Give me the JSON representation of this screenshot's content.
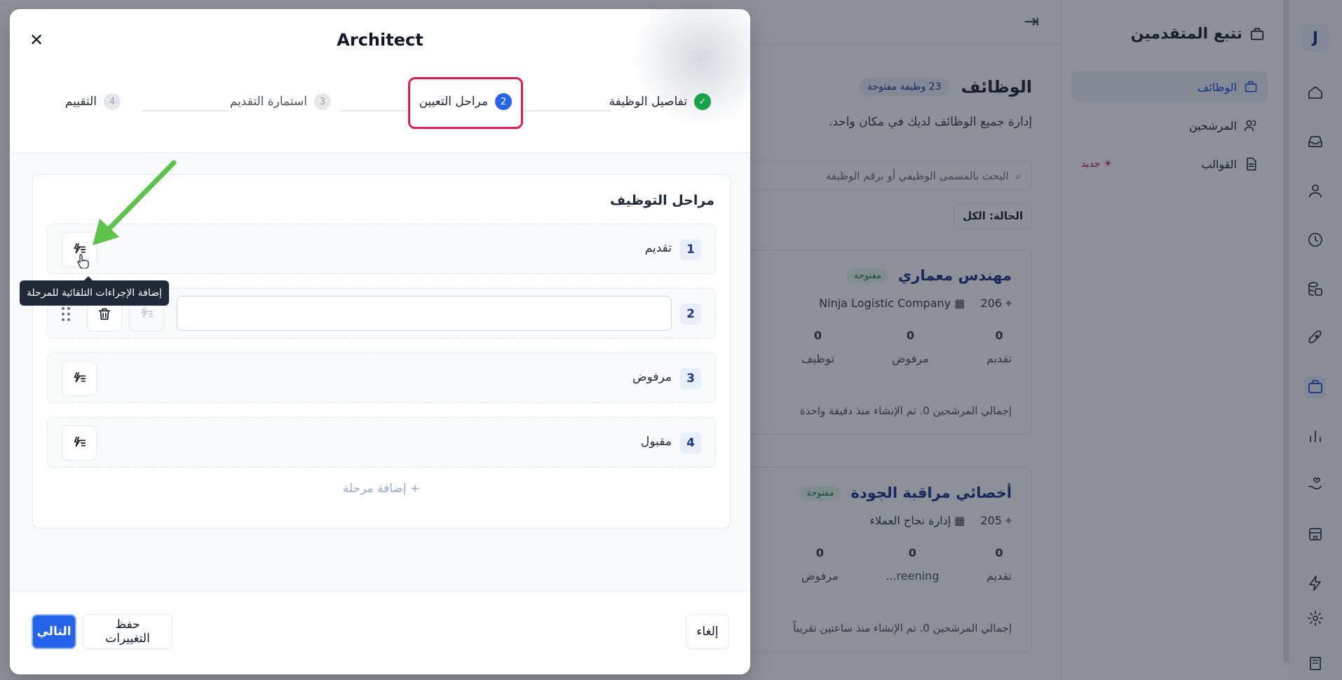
{
  "background": {
    "rail_logo": "J",
    "subnav": {
      "title": "تتبع المتقدمين",
      "items": [
        {
          "label": "الوظائف",
          "active": true
        },
        {
          "label": "المرشحين",
          "active": false
        },
        {
          "label": "القوالب",
          "active": false,
          "badge": "☀ جديد"
        }
      ]
    },
    "main": {
      "heading": "الوظائف",
      "open_jobs_badge": "23 وظيفة مفتوحة",
      "subtitle": "إدارة جميع الوظائف لديك في مكان واحد.",
      "search_placeholder": "البحث بالمسمى الوظيفي أو برقم الوظيفة",
      "status_filter": "الحالة: الكل",
      "cards": [
        {
          "title": "مهندس معماري",
          "status": "مفتوحة",
          "location": "206",
          "company": "Ninja Logistic Company",
          "stats": [
            {
              "value": "0",
              "label": "تقديم"
            },
            {
              "value": "0",
              "label": "مرفوض"
            },
            {
              "value": "0",
              "label": "توظيف"
            }
          ],
          "footer": "إجمالي المرشحين 0. تم الإنشاء منذ دقيقة واحدة"
        },
        {
          "title": "أخصائي مراقبة الجودة",
          "status": "مفتوحة",
          "location": "205",
          "company": "إدارة نجاح العملاء",
          "stats": [
            {
              "value": "0",
              "label": "تقديم"
            },
            {
              "value": "0",
              "label": "reening..."
            },
            {
              "value": "0",
              "label": "مرفوض"
            }
          ],
          "footer": "إجمالي المرشحين 0. تم الإنشاء منذ ساعتين تقريباً"
        }
      ]
    }
  },
  "modal": {
    "title": "Architect",
    "close_label": "✕",
    "steps": [
      {
        "number": "✓",
        "label": "تفاصيل الوظيفة",
        "state": "done"
      },
      {
        "number": "2",
        "label": "مراحل التعيين",
        "state": "current"
      },
      {
        "number": "3",
        "label": "استمارة التقديم",
        "state": "todo"
      },
      {
        "number": "4",
        "label": "التقييم",
        "state": "todo"
      }
    ],
    "panel_title": "مراحل التوظيف",
    "stages": [
      {
        "number": "1",
        "name": "تقديم"
      },
      {
        "number": "2",
        "name": "",
        "editable": true
      },
      {
        "number": "3",
        "name": "مرفوض"
      },
      {
        "number": "4",
        "name": "مقبول"
      }
    ],
    "add_stage": "+  إضافة مرحلة",
    "tooltip": "إضافة الإجراءات التلقائية للمرحلة",
    "footer": {
      "next": "التالي",
      "save": "حفظ التغييرات",
      "cancel": "إلغاء"
    }
  }
}
